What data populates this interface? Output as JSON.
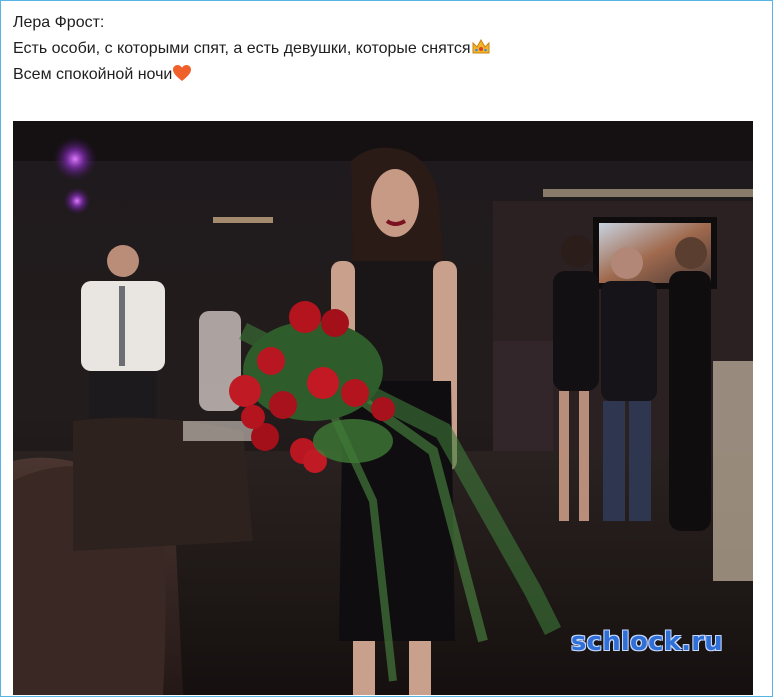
{
  "post": {
    "author": "Лера Фрост:",
    "line1": "Есть особи, с которыми спят, а есть девушки, которые снятся",
    "line2": "Всем спокойной ночи",
    "emoji_line1": "crown-icon",
    "emoji_line2": "heart-icon"
  },
  "photo": {
    "description_icon": "photo-image",
    "watermark": "schlock.ru"
  },
  "colors": {
    "border": "#58b4e6",
    "text": "#1f1f1f",
    "watermark": "#2f6fd6",
    "heart": "#f0602a",
    "crown": "#f5b623"
  }
}
